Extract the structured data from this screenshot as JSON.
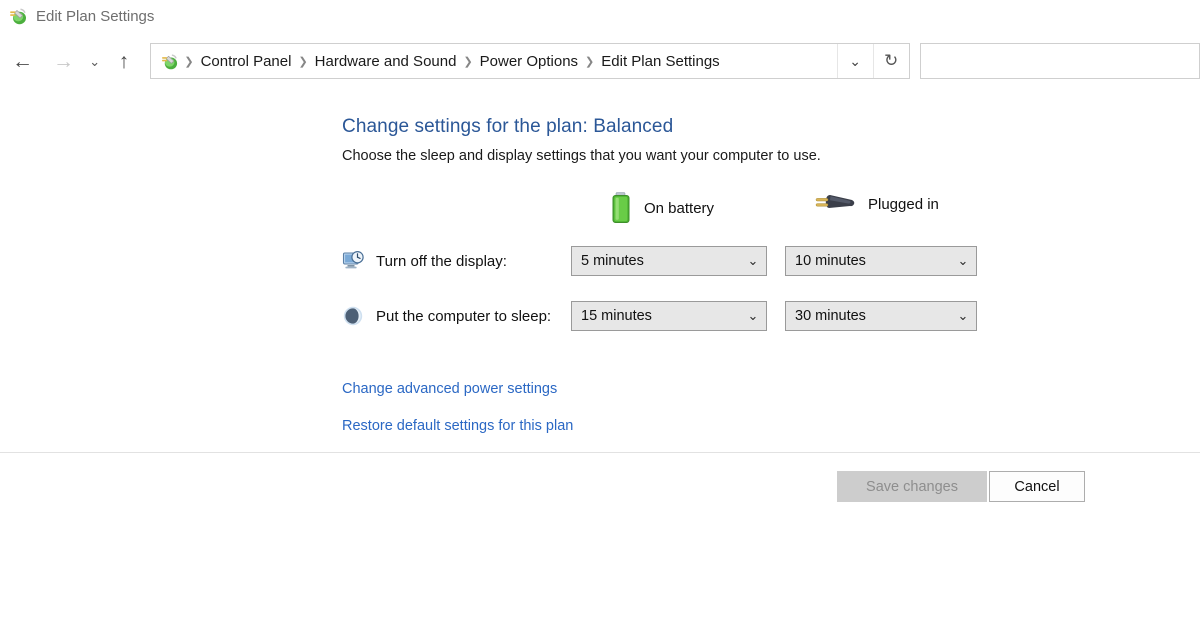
{
  "window": {
    "title": "Edit Plan Settings",
    "icon": "power-plug-icon"
  },
  "navbar": {
    "back_icon": "←",
    "forward_icon": "→",
    "history_icon": "⌄",
    "up_icon": "↑",
    "address_icon": "power-plug-icon",
    "breadcrumb": [
      "Control Panel",
      "Hardware and Sound",
      "Power Options",
      "Edit Plan Settings"
    ],
    "separator": "❯",
    "dropdown_icon": "⌄",
    "refresh_icon": "↻",
    "search_value": "",
    "search_placeholder": ""
  },
  "main": {
    "title": "Change settings for the plan: Balanced",
    "subtitle": "Choose the sleep and display settings that you want your computer to use.",
    "columns": [
      {
        "label": "On battery",
        "icon": "battery-icon"
      },
      {
        "label": "Plugged in",
        "icon": "power-plug-in-icon"
      }
    ],
    "rows": [
      {
        "label": "Turn off the display:",
        "icon": "display-clock-icon",
        "on_battery": "5 minutes",
        "plugged_in": "10 minutes"
      },
      {
        "label": "Put the computer to sleep:",
        "icon": "sleep-moon-icon",
        "on_battery": "15 minutes",
        "plugged_in": "30 minutes"
      }
    ],
    "dropdown_arrow": "⌄",
    "links": [
      "Change advanced power settings",
      "Restore default settings for this plan"
    ]
  },
  "footer": {
    "save_label": "Save changes",
    "cancel_label": "Cancel"
  },
  "colors": {
    "title_blue": "#2b5797",
    "link_blue": "#2b68c4",
    "battery_green": "#5cbf3c",
    "disabled_gray": "#8e8e8e"
  }
}
